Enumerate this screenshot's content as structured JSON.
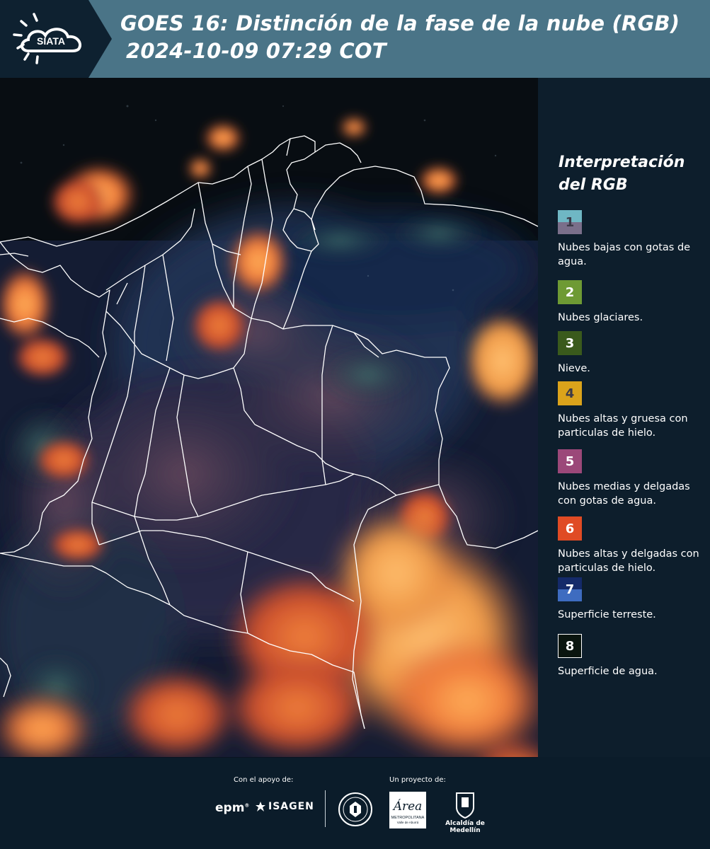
{
  "header": {
    "logo_text": "SIATA",
    "title_line1": "GOES 16: Distinción de la fase de la nube (RGB)",
    "title_line2": "2024-10-09 07:29 COT"
  },
  "legend": {
    "title": "Interpretación del RGB",
    "items": [
      {
        "number": "1",
        "label": "Nubes bajas con gotas de agua.",
        "color_top": "#6fb7c4",
        "color_bottom": "#7a6f8a",
        "number_color": "#3c3a48"
      },
      {
        "number": "2",
        "label": "Nubes glaciares.",
        "color_top": "#6e9a34",
        "color_bottom": "#6e9a34",
        "number_color": "#ffffff"
      },
      {
        "number": "3",
        "label": "Nieve.",
        "color_top": "#3a5a1c",
        "color_bottom": "#3a5a1c",
        "number_color": "#ffffff"
      },
      {
        "number": "4",
        "label": "Nubes altas y gruesa con particulas de hielo.",
        "color_top": "#dba31b",
        "color_bottom": "#dba31b",
        "number_color": "#3c3a48"
      },
      {
        "number": "5",
        "label": "Nubes medias y delgadas con gotas de agua.",
        "color_top": "#9b4879",
        "color_bottom": "#9b4879",
        "number_color": "#ffffff"
      },
      {
        "number": "6",
        "label": "Nubes altas y delgadas con particulas de hielo.",
        "color_top": "#e04b24",
        "color_bottom": "#e04b24",
        "number_color": "#ffffff"
      },
      {
        "number": "7",
        "label": "Superficie terreste.",
        "color_top": "#142a6a",
        "color_bottom": "#3e6cc0",
        "number_color": "#ffffff"
      },
      {
        "number": "8",
        "label": "Superficie de agua.",
        "color_top": "#0a150f",
        "color_bottom": "#0a150f",
        "number_color": "#ffffff"
      }
    ]
  },
  "footer": {
    "support_label": "Con el apoyo de:",
    "project_label": "Un proyecto de:",
    "sponsor_epm": "epm",
    "sponsor_isagen": "ISAGEN",
    "amva_text": "Área",
    "amva_sub": "METROPOLITANA",
    "amva_sub2": "Valle de Aburrá",
    "alcaldia_label": "Alcaldía de Medellín"
  }
}
